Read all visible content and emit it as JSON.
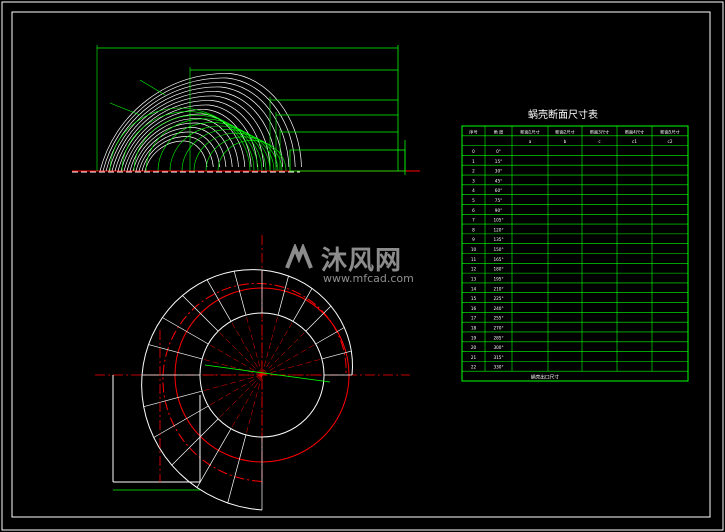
{
  "table": {
    "title": "蜗壳断面尺寸表",
    "headers": [
      "序号",
      "角 度",
      "断面1尺寸",
      "断面2尺寸",
      "断面3尺寸",
      "断面4尺寸",
      "断面5尺寸"
    ],
    "subheaders": [
      "",
      "",
      "a",
      "b",
      "c",
      "c1",
      "c2"
    ],
    "rows": [
      [
        "0",
        "0°",
        "",
        "",
        "",
        "",
        ""
      ],
      [
        "1",
        "15°",
        "",
        "",
        "",
        "",
        ""
      ],
      [
        "2",
        "30°",
        "",
        "",
        "",
        "",
        ""
      ],
      [
        "3",
        "45°",
        "",
        "",
        "",
        "",
        ""
      ],
      [
        "4",
        "60°",
        "",
        "",
        "",
        "",
        ""
      ],
      [
        "5",
        "75°",
        "",
        "",
        "",
        "",
        ""
      ],
      [
        "6",
        "90°",
        "",
        "",
        "",
        "",
        ""
      ],
      [
        "7",
        "105°",
        "",
        "",
        "",
        "",
        ""
      ],
      [
        "8",
        "120°",
        "",
        "",
        "",
        "",
        ""
      ],
      [
        "9",
        "135°",
        "",
        "",
        "",
        "",
        ""
      ],
      [
        "10",
        "150°",
        "",
        "",
        "",
        "",
        ""
      ],
      [
        "11",
        "165°",
        "",
        "",
        "",
        "",
        ""
      ],
      [
        "12",
        "180°",
        "",
        "",
        "",
        "",
        ""
      ],
      [
        "13",
        "195°",
        "",
        "",
        "",
        "",
        ""
      ],
      [
        "14",
        "210°",
        "",
        "",
        "",
        "",
        ""
      ],
      [
        "15",
        "225°",
        "",
        "",
        "",
        "",
        ""
      ],
      [
        "16",
        "240°",
        "",
        "",
        "",
        "",
        ""
      ],
      [
        "17",
        "255°",
        "",
        "",
        "",
        "",
        ""
      ],
      [
        "18",
        "270°",
        "",
        "",
        "",
        "",
        ""
      ],
      [
        "19",
        "285°",
        "",
        "",
        "",
        "",
        ""
      ],
      [
        "20",
        "300°",
        "",
        "",
        "",
        "",
        ""
      ],
      [
        "21",
        "315°",
        "",
        "",
        "",
        "",
        ""
      ],
      [
        "22",
        "330°",
        "",
        "",
        "",
        "",
        ""
      ]
    ],
    "footer": "蜗壳出口尺寸"
  },
  "watermark": {
    "main": "沐风网",
    "sub": "www.mfcad.com"
  },
  "colors": {
    "background": "#000000",
    "outline": "#ffffff",
    "dimension": "#00ff00",
    "centerline": "#ff0000",
    "table": "#00ff00"
  }
}
